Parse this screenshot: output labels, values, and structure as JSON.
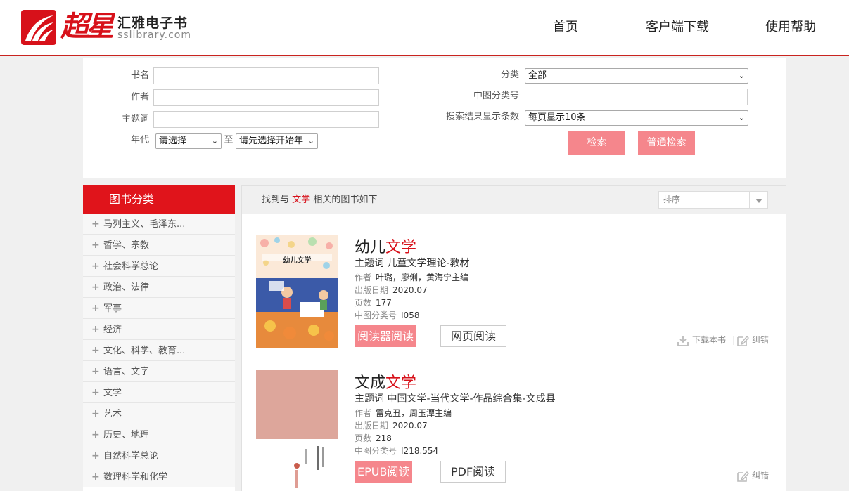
{
  "header": {
    "logo_cn": "超星",
    "logo_name": "汇雅电子书",
    "logo_url": "sslibrary.com",
    "nav": [
      "首页",
      "客户端下载",
      "使用帮助"
    ]
  },
  "search": {
    "book_name_label": "书名",
    "author_label": "作者",
    "keyword_label": "主题词",
    "year_label": "年代",
    "year_from": "请选择",
    "year_sep": "至",
    "year_to": "请先选择开始年",
    "category_label": "分类",
    "category_value": "全部",
    "clc_label": "中图分类号",
    "page_size_label": "搜索结果显示条数",
    "page_size_value": "每页显示10条",
    "search_button": "检索",
    "normal_search_button": "普通检索"
  },
  "sidebar": {
    "title": "图书分类",
    "items": [
      "马列主义、毛泽东...",
      "哲学、宗教",
      "社会科学总论",
      "政治、法律",
      "军事",
      "经济",
      "文化、科学、教育...",
      "语言、文字",
      "文学",
      "艺术",
      "历史、地理",
      "自然科学总论",
      "数理科学和化学"
    ]
  },
  "results": {
    "found_prefix": "找到与",
    "keyword": "文学",
    "found_suffix": "相关的图书如下",
    "sort_placeholder": "排序",
    "books": [
      {
        "title_prefix": "幼儿",
        "title_kw": "文学",
        "subject_label": "主题词",
        "subject": "儿童文学理论-教材",
        "author_label": "作者",
        "author": "叶璐，廖俐，黄海宁主编",
        "date_label": "出版日期",
        "date": "2020.07",
        "pages_label": "页数",
        "pages": "177",
        "clc_label": "中图分类号",
        "clc": "I058",
        "read_button": "阅读器阅读",
        "web_button": "网页阅读",
        "download_label": "下载本书",
        "correct_label": "纠错",
        "cover_title": "幼儿文学"
      },
      {
        "title_prefix": "文成",
        "title_kw": "文学",
        "subject_label": "主题词",
        "subject": "中国文学-当代文学-作品综合集-文成县",
        "author_label": "作者",
        "author": "雷克丑，周玉潭主编",
        "date_label": "出版日期",
        "date": "2020.07",
        "pages_label": "页数",
        "pages": "218",
        "clc_label": "中图分类号",
        "clc": "I218.554",
        "read_button": "EPUB阅读",
        "web_button": "PDF阅读",
        "correct_label": "纠错"
      }
    ]
  },
  "colors": {
    "brand_red": "#d7111a",
    "button_pink": "#f5868c"
  }
}
